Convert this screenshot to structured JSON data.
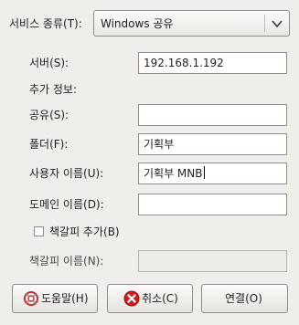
{
  "service_type": {
    "label": "서비스 종류(T):",
    "value": "Windows 공유"
  },
  "form": {
    "server": {
      "label": "서버(S):",
      "value": "192.168.1.192"
    },
    "optional_heading": "추가 정보:",
    "share": {
      "label": "공유(S):",
      "value": ""
    },
    "folder": {
      "label": "폴더(F):",
      "value": "기획부"
    },
    "username": {
      "label": "사용자 이름(U):",
      "value": "기획부 MNB"
    },
    "domain": {
      "label": "도메인 이름(D):",
      "value": ""
    },
    "add_bookmark": {
      "label": "책갈피 추가(B)",
      "checked": false
    },
    "bookmark_name": {
      "label": "책갈피 이름(N):",
      "value": "",
      "enabled": false
    }
  },
  "buttons": {
    "help": "도움말(H)",
    "cancel": "취소(C)",
    "connect": "연결(O)"
  },
  "colors": {
    "background": "#efeeea",
    "cancel_icon": "#d01c1c",
    "help_icon": "#c62a2a"
  }
}
